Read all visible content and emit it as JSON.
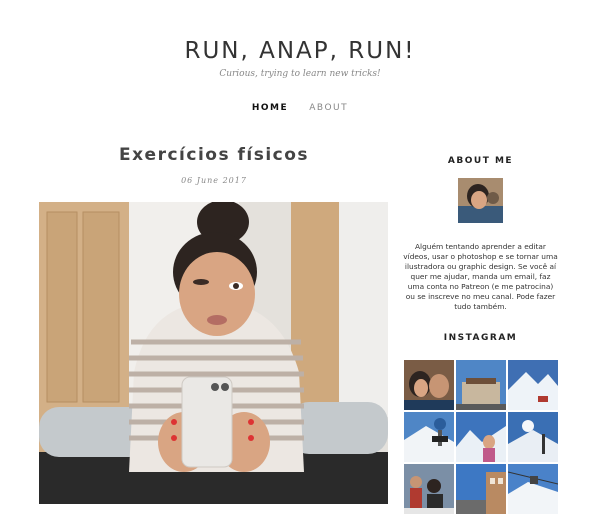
{
  "site": {
    "title": "RUN, ANAP, RUN!",
    "tagline": "Curious, trying to learn new tricks!"
  },
  "nav": {
    "items": [
      {
        "label": "HOME",
        "active": true
      },
      {
        "label": "ABOUT",
        "active": false
      }
    ]
  },
  "post": {
    "title": "Exercícios físicos",
    "date": "06 June 2017"
  },
  "sidebar": {
    "about": {
      "heading": "ABOUT ME",
      "text": "Alguém tentando aprender a editar vídeos, usar o photoshop e se tornar uma ilustradora ou graphic design. Se você aí quer me ajudar, manda um email, faz uma conta no Patreon (e me patrocina) ou se inscreve no meu canal. Pode fazer tudo também."
    },
    "instagram": {
      "heading": "INSTAGRAM",
      "tiles": [
        "selfie-couple",
        "building-sky",
        "snow-mountain",
        "snow-sign",
        "snow-person",
        "snow-trees",
        "group-photo",
        "street-sky",
        "snow-lift"
      ]
    }
  },
  "colors": {
    "text": "#333333",
    "muted": "#888888",
    "background": "#ffffff"
  }
}
